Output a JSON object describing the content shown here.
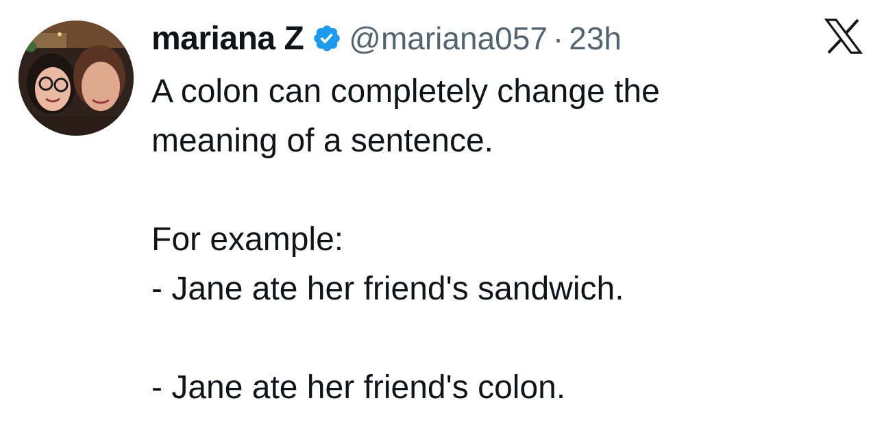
{
  "tweet": {
    "author": {
      "display_name": "mariana Z",
      "handle": "@mariana057",
      "verified": true
    },
    "separator": "·",
    "timestamp": "23h",
    "lines": [
      "A colon can completely change the",
      "meaning of a sentence.",
      "",
      "For example:",
      "- Jane ate her friend's sandwich.",
      "",
      "- Jane ate her friend's colon."
    ]
  },
  "icons": {
    "verified": "verified-badge-icon",
    "platform": "x-logo-icon"
  },
  "colors": {
    "text_primary": "#0f1419",
    "text_secondary": "#536471",
    "verified_blue": "#1d9bf0",
    "background": "#ffffff"
  }
}
